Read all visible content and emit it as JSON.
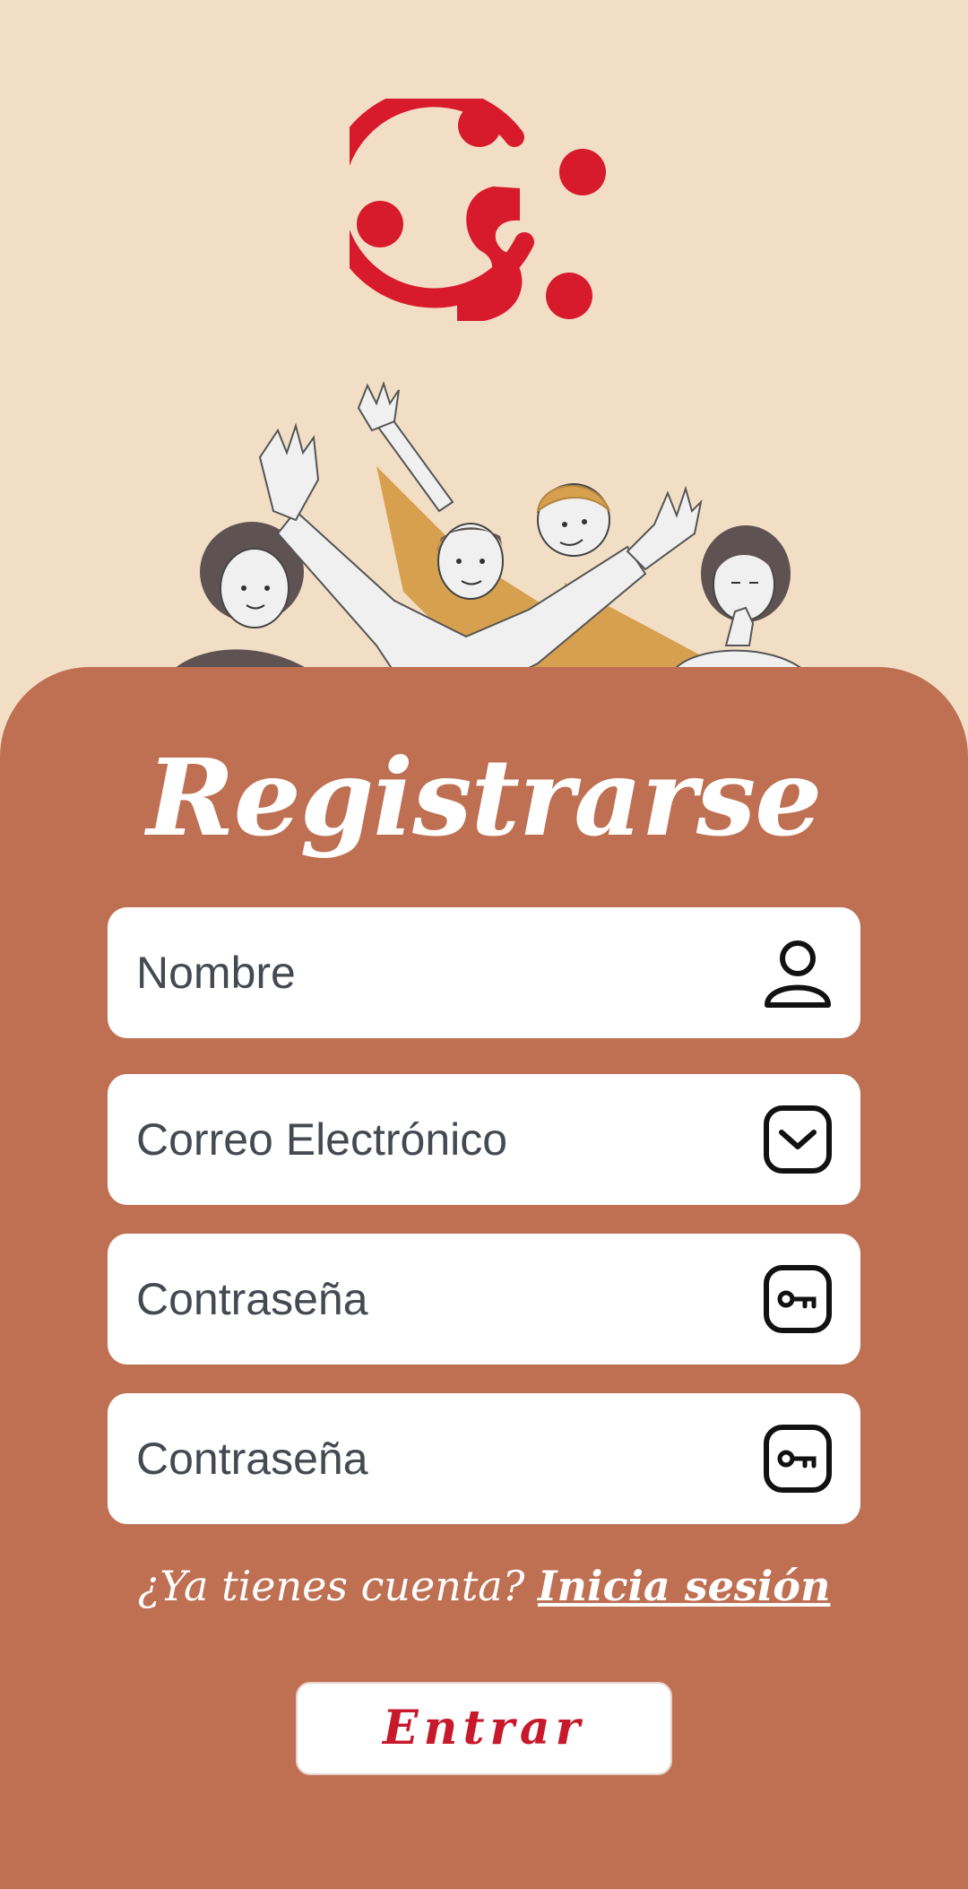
{
  "colors": {
    "background": "#f2dec5",
    "panel": "#bf7052",
    "brand_red": "#d71a2c",
    "field_bg": "#ffffff",
    "field_text": "#454a52"
  },
  "header": {
    "logo_icon": "brand-logo-icon",
    "illustration": "group-of-people-illustration"
  },
  "form": {
    "title": "Registrarse",
    "fields": [
      {
        "placeholder": "Nombre",
        "icon": "user-icon"
      },
      {
        "placeholder": "Correo Electrónico",
        "icon": "mail-icon"
      },
      {
        "placeholder": "Contraseña",
        "icon": "key-icon"
      },
      {
        "placeholder": "Contraseña",
        "icon": "key-icon"
      }
    ],
    "have_account_text": "¿Ya tienes cuenta?",
    "login_link": "Inicia sesión",
    "submit_label": "Entrar"
  }
}
